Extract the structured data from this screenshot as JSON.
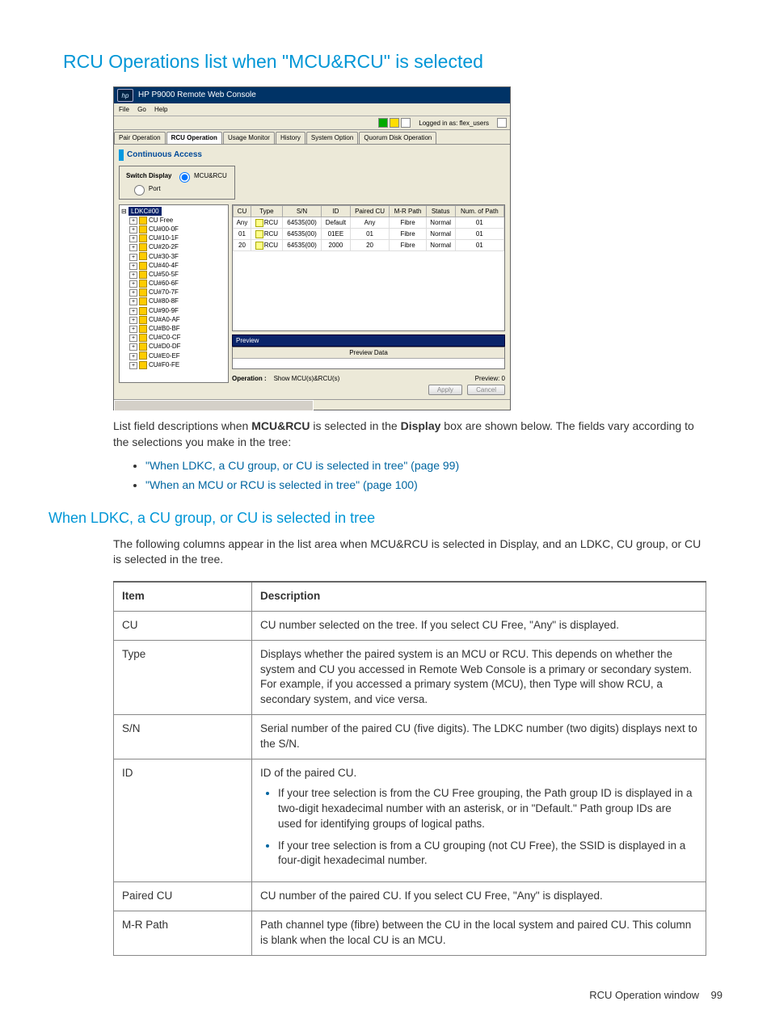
{
  "page": {
    "title": "RCU Operations list when \"MCU&RCU\" is selected",
    "intro": "List field descriptions when MCU&RCU is selected in the Display box are shown below. The fields vary according to the selections you make in the tree:",
    "bullets": [
      "\"When LDKC, a CU group, or CU is selected in tree\" (page 99)",
      "\"When an MCU or RCU is selected in tree\" (page 100)"
    ],
    "sub_heading": "When LDKC, a CU group, or CU is selected in tree",
    "sub_intro": "The following columns appear in the list area when MCU&RCU is selected in Display, and an LDKC, CU group, or CU is selected in the tree."
  },
  "console": {
    "title": "HP P9000 Remote Web Console",
    "menus": [
      "File",
      "Go",
      "Help"
    ],
    "logged_in": "Logged in as: flex_users",
    "tabs": [
      "Pair Operation",
      "RCU Operation",
      "Usage Monitor",
      "History",
      "System Option",
      "Quorum Disk Operation"
    ],
    "active_tab": "RCU Operation",
    "heading": "Continuous Access",
    "switch_legend": "Switch Display",
    "switch_opts": [
      "MCU&RCU",
      "Port"
    ],
    "tree_root": "LDKC#00",
    "tree_items": [
      "CU Free",
      "CU#00-0F",
      "CU#10-1F",
      "CU#20-2F",
      "CU#30-3F",
      "CU#40-4F",
      "CU#50-5F",
      "CU#60-6F",
      "CU#70-7F",
      "CU#80-8F",
      "CU#90-9F",
      "CU#A0-AF",
      "CU#B0-BF",
      "CU#C0-CF",
      "CU#D0-DF",
      "CU#E0-EF",
      "CU#F0-FE"
    ],
    "grid_headers": [
      "CU",
      "Type",
      "S/N",
      "ID",
      "Paired CU",
      "M-R Path",
      "Status",
      "Num. of Path"
    ],
    "grid_rows": [
      {
        "cu": "Any",
        "type": "RCU",
        "sn": "64535(00)",
        "id": "Default",
        "paired": "Any",
        "mr": "Fibre",
        "status": "Normal",
        "num": "01"
      },
      {
        "cu": "01",
        "type": "RCU",
        "sn": "64535(00)",
        "id": "01EE",
        "paired": "01",
        "mr": "Fibre",
        "status": "Normal",
        "num": "01"
      },
      {
        "cu": "20",
        "type": "RCU",
        "sn": "64535(00)",
        "id": "2000",
        "paired": "20",
        "mr": "Fibre",
        "status": "Normal",
        "num": "01"
      }
    ],
    "preview_label": "Preview",
    "preview_data_label": "Preview Data",
    "op_label": "Operation :",
    "op_value": "Show MCU(s)&RCU(s)",
    "preview_count_label": "Preview: 0",
    "apply_btn": "Apply",
    "cancel_btn": "Cancel"
  },
  "desc_table": {
    "headers": [
      "Item",
      "Description"
    ],
    "rows": [
      {
        "item": "CU",
        "desc": "CU number selected on the tree. If you select CU Free, \"Any\" is displayed."
      },
      {
        "item": "Type",
        "desc": "Displays whether the paired system is an MCU or RCU. This depends on whether the system and CU you accessed in Remote Web Console is a primary or secondary system. For example, if you accessed a primary system (MCU), then Type will show RCU, a secondary system, and vice versa."
      },
      {
        "item": "S/N",
        "desc": "Serial number of the paired CU (five digits). The LDKC number (two digits) displays next to the S/N."
      },
      {
        "item": "ID",
        "desc": "ID of the paired CU.",
        "list": [
          "If your tree selection is from the CU Free grouping, the Path group ID is displayed in a two-digit hexadecimal number with an asterisk, or in \"Default.\" Path group IDs are used for identifying groups of logical paths.",
          "If your tree selection is from a CU grouping (not CU Free), the SSID is displayed in a four-digit hexadecimal number."
        ]
      },
      {
        "item": "Paired CU",
        "desc": "CU number of the paired CU. If you select CU Free, \"Any\" is displayed."
      },
      {
        "item": "M-R Path",
        "desc": "Path channel type (fibre) between the CU in the local system and paired CU. This column is blank when the local CU is an MCU."
      }
    ]
  },
  "footer": {
    "text": "RCU Operation window",
    "page": "99"
  }
}
